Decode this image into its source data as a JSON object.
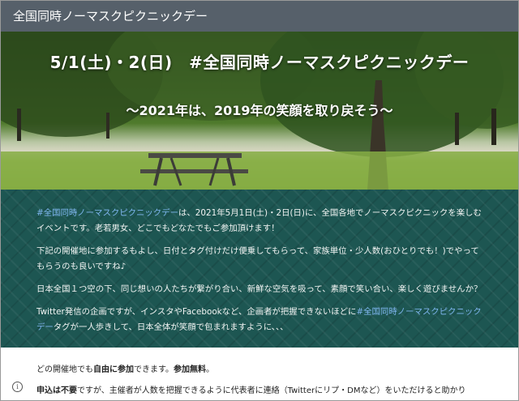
{
  "topbar": {
    "title": "全国同時ノーマスクピクニックデー"
  },
  "hero": {
    "title": "5/1(土)・2(日)　#全国同時ノーマスクピクニックデー",
    "subtitle": "〜2021年は、2019年の笑顔を取り戻そう〜"
  },
  "intro": {
    "p1_tag": "#全国同時ノーマスクピクニックデー",
    "p1_rest": "は、2021年5月1日(土)・2日(日)に、全国各地でノーマスクピクニックを楽しむイベントです。老若男女、どこでもどなたでもご参加頂けます！",
    "p2": "下記の開催地に参加するもよし、日付とタグ付けだけ便乗してもらって、家族単位・少人数(おひとりでも！)でやってもらうのも良いですね♪",
    "p3": "日本全国１つ空の下、同じ想いの人たちが繋がり合い、新鮮な空気を吸って、素顔で笑い合い、楽しく遊びませんか？",
    "p4_a": "Twitter発信の企画ですが、インスタやFacebookなど、企画者が把握できないほどに",
    "p4_tag": "#全国同時ノーマスクピクニックデー",
    "p4_b": "タグが一人歩きして、日本全体が笑顔で包まれますように、、、"
  },
  "lower": {
    "l1_a": "どの開催地でも",
    "l1_b": "自由に参加",
    "l1_c": "できます。",
    "l1_d": "参加無料",
    "l1_e": "。",
    "l2_a": "申込は不要",
    "l2_b": "ですが、主催者が人数を把握できるように代表者に連絡（Twitterにリプ・DMなど）をいただけると助かり"
  },
  "icons": {
    "info": "info-icon"
  }
}
